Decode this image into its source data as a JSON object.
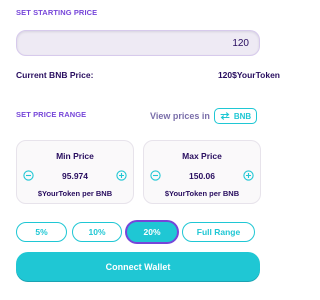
{
  "start_price": {
    "section_label": "SET STARTING PRICE",
    "input_value": "120"
  },
  "current_price": {
    "label": "Current BNB Price:",
    "value": "120",
    "unit": "$YourToken"
  },
  "price_range": {
    "section_label": "SET PRICE RANGE",
    "view_prices_label": "View prices in",
    "toggle_label": "BNB",
    "toggle_icon": "swap-arrows-icon",
    "min": {
      "title": "Min Price",
      "value": "95.974",
      "unit": "$YourToken per BNB"
    },
    "max": {
      "title": "Max Price",
      "value": "150.06",
      "unit": "$YourToken per BNB"
    }
  },
  "percent_buttons": [
    {
      "label": "5%",
      "selected": false
    },
    {
      "label": "10%",
      "selected": false
    },
    {
      "label": "20%",
      "selected": true
    },
    {
      "label": "Full Range",
      "selected": false
    }
  ],
  "connect_button": {
    "label": "Connect Wallet"
  },
  "colors": {
    "primary": "#1fc7d4",
    "secondary": "#7645d9",
    "text": "#280d5f",
    "subtle": "#7a6eaa",
    "input_bg": "#eeeaf4",
    "card_bg": "#faf9fa"
  }
}
